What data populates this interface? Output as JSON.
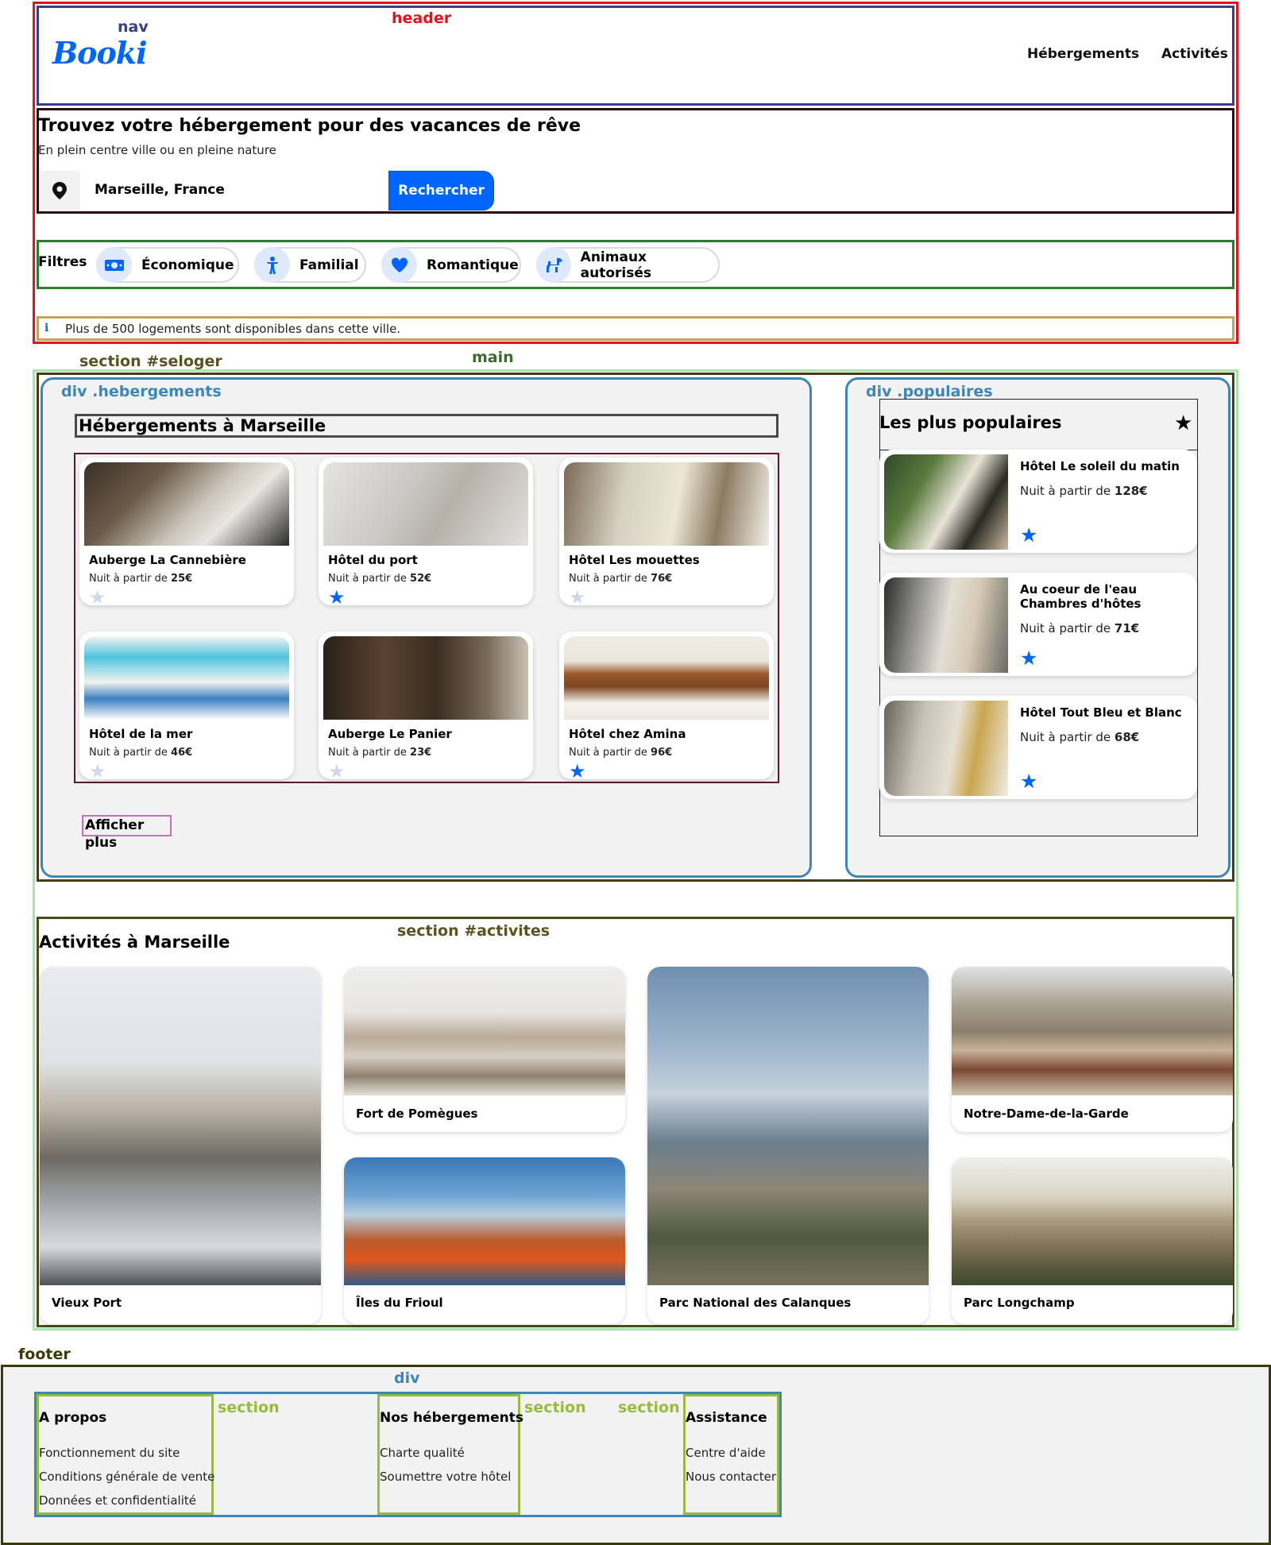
{
  "annotations": {
    "header": "header",
    "nav": "nav",
    "main": "main",
    "section_seloger": "section #seloger",
    "div_hebergements": "div .hebergements",
    "div_populaires": "div .populaires",
    "section_activites": "section #activites",
    "footer": "footer",
    "footer_div": "div",
    "section": "section"
  },
  "nav": {
    "logo": "Booki",
    "links": [
      "Hébergements",
      "Activités"
    ]
  },
  "hero": {
    "title": "Trouvez votre hébergement pour des vacances de rêve",
    "subtitle": "En plein centre ville ou en pleine nature",
    "search_value": "Marseille, France",
    "search_button": "Rechercher"
  },
  "filters": {
    "label": "Filtres",
    "items": [
      "Économique",
      "Familial",
      "Romantique",
      "Animaux autorisés"
    ]
  },
  "info": {
    "icon": "info-icon",
    "text": "Plus de 500 logements sont disponibles dans cette ville."
  },
  "hebergements": {
    "title": "Hébergements à Marseille",
    "price_prefix": "Nuit à partir de",
    "items": [
      {
        "name": "Auberge La Cannebière",
        "price": "25€",
        "rating": 0
      },
      {
        "name": "Hôtel du port",
        "price": "52€",
        "rating": 1
      },
      {
        "name": "Hôtel Les mouettes",
        "price": "76€",
        "rating": 0
      },
      {
        "name": "Hôtel de la mer",
        "price": "46€",
        "rating": 0
      },
      {
        "name": "Auberge Le Panier",
        "price": "23€",
        "rating": 0
      },
      {
        "name": "Hôtel chez Amina",
        "price": "96€",
        "rating": 1
      }
    ],
    "more": "Afficher plus"
  },
  "populaires": {
    "title": "Les plus populaires",
    "price_prefix": "Nuit à partir de",
    "items": [
      {
        "name": "Hôtel Le soleil du matin",
        "price": "128€",
        "rating": 1
      },
      {
        "name": "Au coeur de l'eau Chambres d'hôtes",
        "price": "71€",
        "rating": 1
      },
      {
        "name": "Hôtel Tout Bleu et Blanc",
        "price": "68€",
        "rating": 1
      }
    ]
  },
  "activites": {
    "title": "Activités à Marseille",
    "items": [
      "Vieux Port",
      "Fort de Pomègues",
      "Îles du Frioul",
      "Parc National des Calanques",
      "Notre-Dame-de-la-Garde",
      "Parc Longchamp"
    ]
  },
  "footer": {
    "sections": [
      {
        "title": "A propos",
        "links": [
          "Fonctionnement du site",
          "Conditions générale de vente",
          "Données et confidentialité"
        ]
      },
      {
        "title": "Nos hébergements",
        "links": [
          "Charte qualité",
          "Soumettre votre hôtel"
        ]
      },
      {
        "title": "Assistance",
        "links": [
          "Centre d'aide",
          "Nous contacter"
        ]
      }
    ]
  },
  "colors": {
    "accent": "#0065fc",
    "header_outline": "#e8111b",
    "nav_outline": "#3a3e8a",
    "filters_outline": "#2a7d31",
    "main_outline": "#a9e3ab",
    "div_outline": "#3e85b8",
    "section_outline": "#9ab93f"
  }
}
